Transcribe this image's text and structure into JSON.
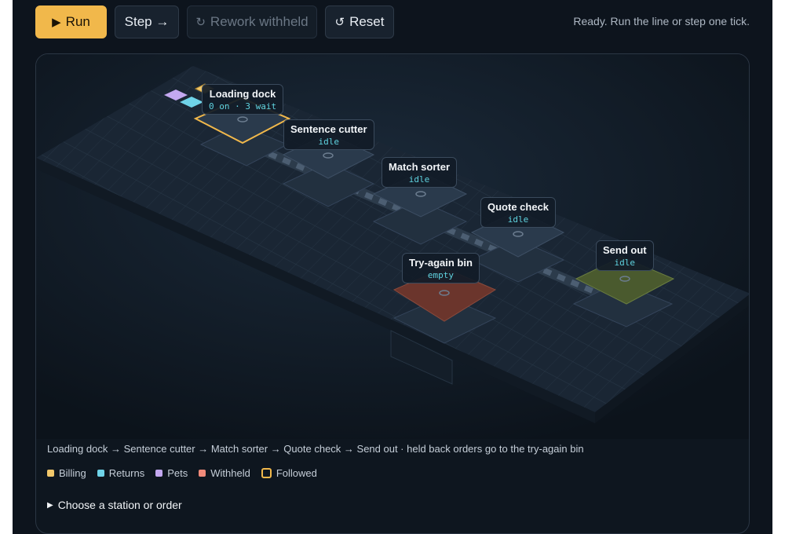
{
  "toolbar": {
    "run_label": "Run",
    "step_label": "Step →",
    "rework_label": "Rework withheld",
    "reset_label": "Reset"
  },
  "status_text": "Ready. Run the line or step one tick.",
  "stations": [
    {
      "name": "Loading dock",
      "status": "0 on · 3 wait"
    },
    {
      "name": "Sentence cutter",
      "status": "idle"
    },
    {
      "name": "Match sorter",
      "status": "idle"
    },
    {
      "name": "Quote check",
      "status": "idle"
    },
    {
      "name": "Send out",
      "status": "idle"
    },
    {
      "name": "Try-again bin",
      "status": "empty"
    }
  ],
  "flow_caption": "Loading dock → Sentence cutter → Match sorter → Quote check → Send out · held back orders go to the try-again bin",
  "legend": [
    {
      "label": "Billing",
      "color": "#f1c76a"
    },
    {
      "label": "Returns",
      "color": "#6fd3e8"
    },
    {
      "label": "Pets",
      "color": "#c3a8f0"
    },
    {
      "label": "Withheld",
      "color": "#f08a7a"
    },
    {
      "label": "Followed",
      "color": "#f1b84b"
    }
  ],
  "picker_label": "Choose a station or order"
}
